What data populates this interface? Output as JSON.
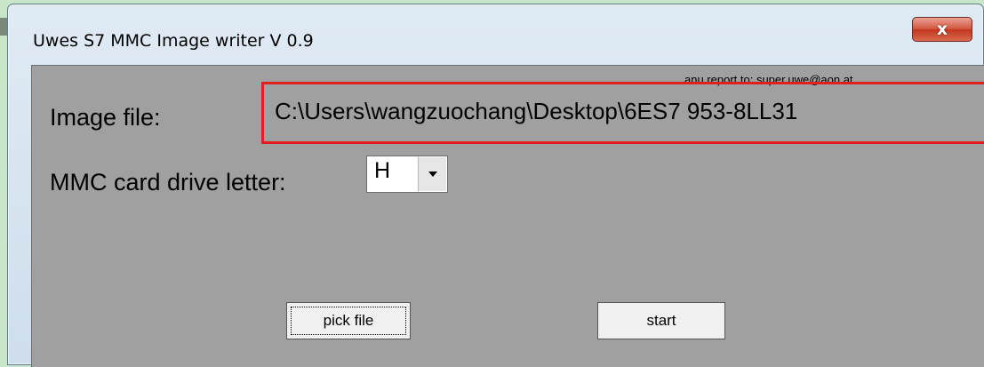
{
  "window": {
    "title": "Uwes S7 MMC Image writer V 0.9",
    "close_glyph": "x"
  },
  "report_line": "anu report to: super.uwe@aon.at",
  "image_file": {
    "label": "Image file:",
    "path": "C:\\Users\\wangzuochang\\Desktop\\6ES7 953-8LL31",
    "highlight_color": "#e21f1f"
  },
  "mmc": {
    "label": "MMC card drive letter:",
    "selected_drive": "H",
    "arrow_icon": "chevron-down-icon"
  },
  "buttons": {
    "pick_file": "pick file",
    "start": "start"
  },
  "colors": {
    "client_bg": "#a0a0a0",
    "close_button": "#c2361e"
  }
}
